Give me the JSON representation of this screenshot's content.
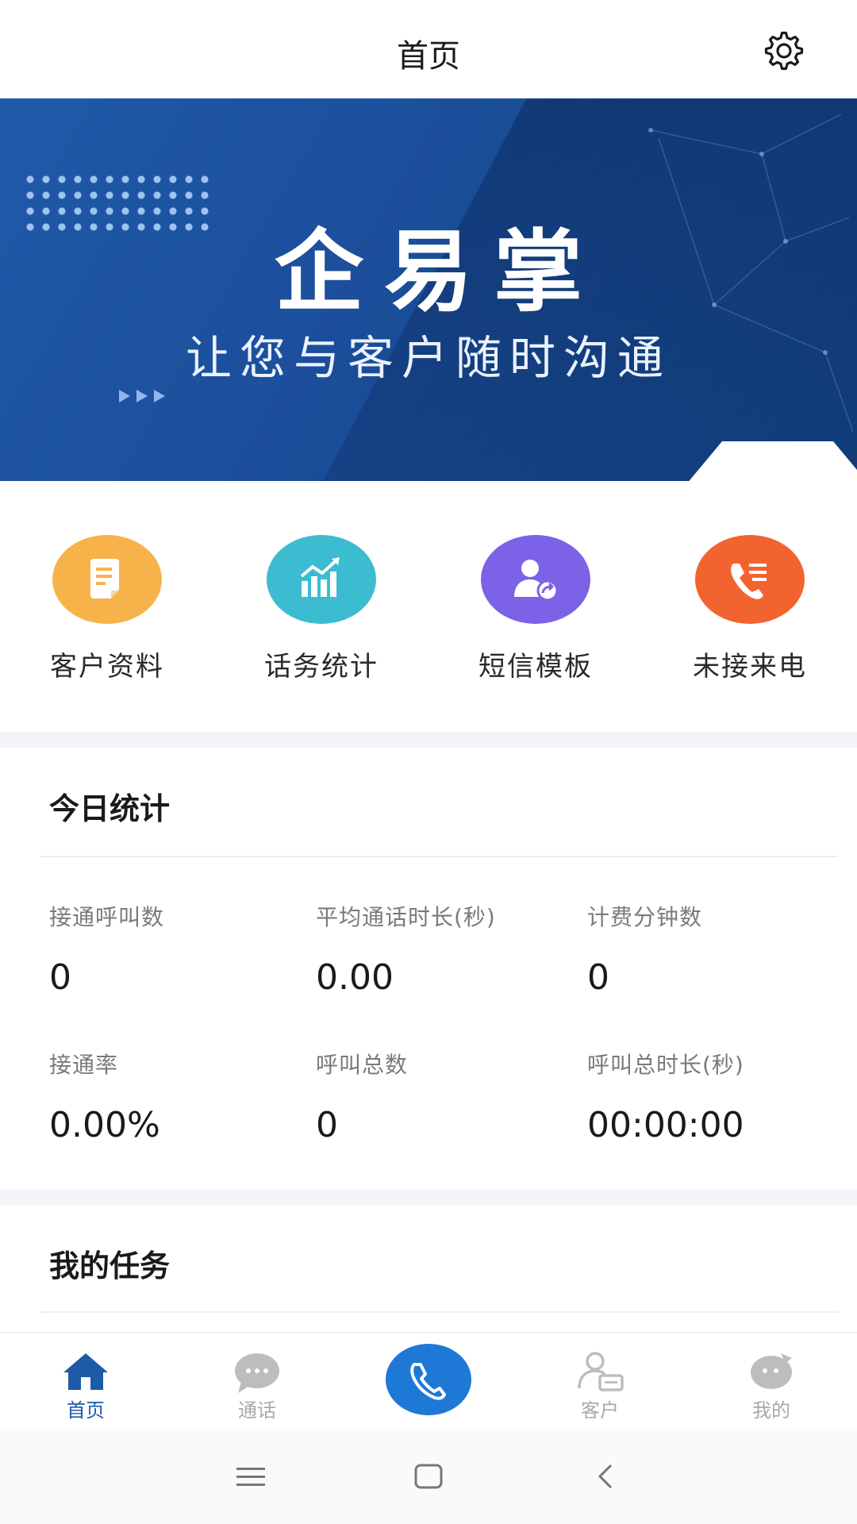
{
  "header": {
    "title": "首页",
    "settings_icon": "gear-icon"
  },
  "banner": {
    "title": "企易掌",
    "subtitle": "让您与客户随时沟通"
  },
  "quick_entries": [
    {
      "label": "客户资料",
      "icon": "document-icon",
      "color": "#F7B24A"
    },
    {
      "label": "话务统计",
      "icon": "bar-chart-icon",
      "color": "#3CBCD0"
    },
    {
      "label": "短信模板",
      "icon": "user-share-icon",
      "color": "#7B62E6"
    },
    {
      "label": "未接来电",
      "icon": "phone-list-icon",
      "color": "#F2632F"
    }
  ],
  "today_stats": {
    "title": "今日统计",
    "items": [
      {
        "label": "接通呼叫数",
        "value": "0"
      },
      {
        "label": "平均通话时长(秒)",
        "value": "0.00"
      },
      {
        "label": "计费分钟数",
        "value": "0"
      },
      {
        "label": "接通率",
        "value": "0.00%"
      },
      {
        "label": "呼叫总数",
        "value": "0"
      },
      {
        "label": "呼叫总时长(秒)",
        "value": "00:00:00"
      }
    ]
  },
  "tasks": {
    "title": "我的任务"
  },
  "bottom_nav": {
    "active_color": "#1D5AA8",
    "items": [
      {
        "label": "首页",
        "icon": "home-icon"
      },
      {
        "label": "通话",
        "icon": "chat-bubble-icon"
      },
      {
        "label": "客户",
        "icon": "contact-card-icon"
      },
      {
        "label": "我的",
        "icon": "profile-bubble-icon"
      }
    ],
    "center_icon": "phone-icon"
  },
  "system_nav": {
    "icons": [
      "menu-icon",
      "home-square-icon",
      "back-icon"
    ]
  }
}
